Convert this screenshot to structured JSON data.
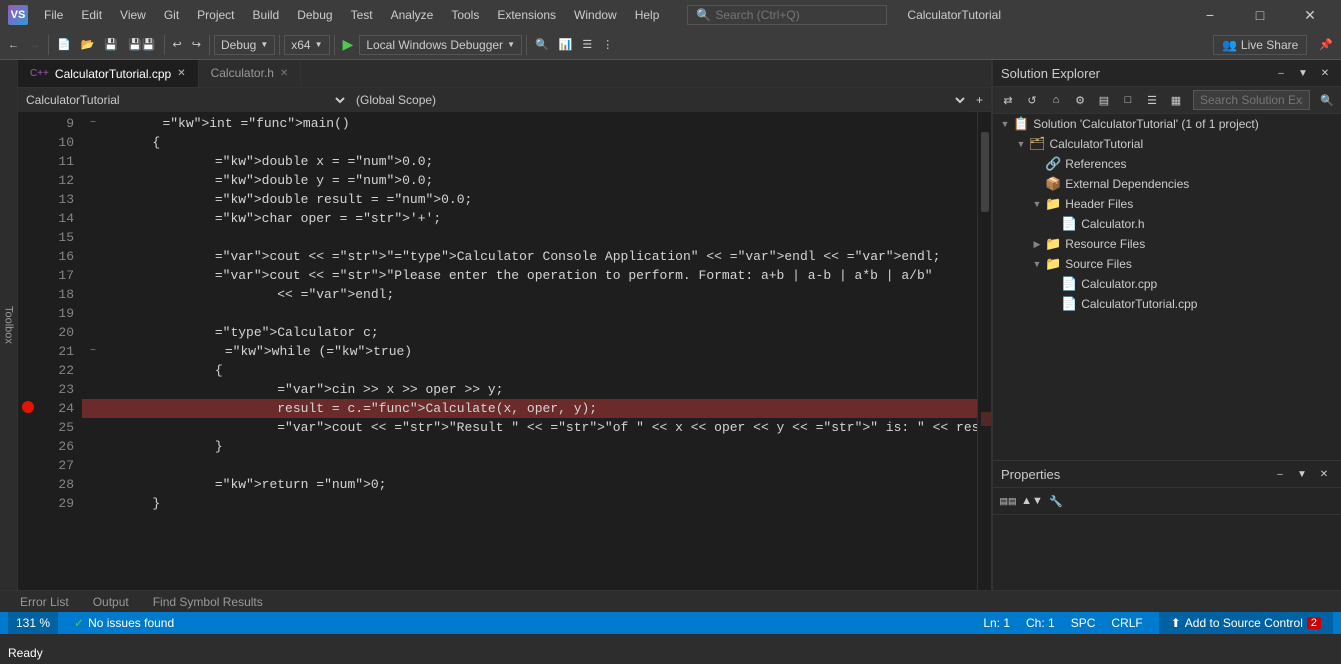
{
  "titleBar": {
    "logo": "VS",
    "menus": [
      "File",
      "Edit",
      "View",
      "Git",
      "Project",
      "Build",
      "Debug",
      "Test",
      "Analyze",
      "Tools",
      "Extensions",
      "Window",
      "Help"
    ],
    "search": {
      "placeholder": "Search (Ctrl+Q)"
    },
    "windowTitle": "CalculatorTutorial",
    "controls": [
      "minimize",
      "restore",
      "close"
    ]
  },
  "toolbar": {
    "debug_config": "Debug",
    "platform": "x64",
    "run_label": "Local Windows Debugger",
    "live_share": "Live Share"
  },
  "editor": {
    "tabs": [
      {
        "label": "CalculatorTutorial.cpp",
        "active": true
      },
      {
        "label": "Calculator.h",
        "active": false
      }
    ],
    "nav": {
      "scope": "CalculatorTutorial",
      "context": "(Global Scope)"
    },
    "lines": [
      {
        "num": 9,
        "content": "\tint main()",
        "indent": 1,
        "collapse": true
      },
      {
        "num": 10,
        "content": "\t{",
        "indent": 1
      },
      {
        "num": 11,
        "content": "\t\tdouble x = 0.0;",
        "indent": 2
      },
      {
        "num": 12,
        "content": "\t\tdouble y = 0.0;",
        "indent": 2
      },
      {
        "num": 13,
        "content": "\t\tdouble result = 0.0;",
        "indent": 2
      },
      {
        "num": 14,
        "content": "\t\tchar oper = '+';",
        "indent": 2
      },
      {
        "num": 15,
        "content": "",
        "indent": 0
      },
      {
        "num": 16,
        "content": "\t\tcout << \"Calculator Console Application\" << endl << endl;",
        "indent": 2
      },
      {
        "num": 17,
        "content": "\t\tcout << \"Please enter the operation to perform. Format: a+b | a-b | a*b | a/b\"",
        "indent": 2
      },
      {
        "num": 18,
        "content": "\t\t\t<< endl;",
        "indent": 3
      },
      {
        "num": 19,
        "content": "",
        "indent": 0
      },
      {
        "num": 20,
        "content": "\t\tCalculator c;",
        "indent": 2
      },
      {
        "num": 21,
        "content": "\t\twhile (true)",
        "indent": 2,
        "collapse": true
      },
      {
        "num": 22,
        "content": "\t\t{",
        "indent": 2
      },
      {
        "num": 23,
        "content": "\t\t\tcin >> x >> oper >> y;",
        "indent": 3
      },
      {
        "num": 24,
        "content": "\t\t\tresult = c.Calculate(x, oper, y);",
        "indent": 3,
        "highlighted": true,
        "breakpoint": true
      },
      {
        "num": 25,
        "content": "\t\t\tcout << \"Result \" << \"of \" << x << oper << y << \" is: \" << result << endl;",
        "indent": 3
      },
      {
        "num": 26,
        "content": "\t\t}",
        "indent": 2
      },
      {
        "num": 27,
        "content": "",
        "indent": 0
      },
      {
        "num": 28,
        "content": "\t\treturn 0;",
        "indent": 2
      },
      {
        "num": 29,
        "content": "\t}",
        "indent": 1
      }
    ]
  },
  "solutionExplorer": {
    "title": "Solution Explorer",
    "search_placeholder": "Search Solution Explorer (Ctrl+;)",
    "tree": [
      {
        "level": 0,
        "icon": "solution",
        "label": "Solution 'CalculatorTutorial' (1 of 1 project)",
        "expanded": true
      },
      {
        "level": 1,
        "icon": "project",
        "label": "CalculatorTutorial",
        "expanded": true
      },
      {
        "level": 2,
        "icon": "references",
        "label": "References",
        "expanded": false
      },
      {
        "level": 2,
        "icon": "ext-deps",
        "label": "External Dependencies",
        "expanded": false
      },
      {
        "level": 2,
        "icon": "folder",
        "label": "Header Files",
        "expanded": true
      },
      {
        "level": 3,
        "icon": "h-file",
        "label": "Calculator.h",
        "expanded": false
      },
      {
        "level": 2,
        "icon": "folder",
        "label": "Resource Files",
        "expanded": false
      },
      {
        "level": 2,
        "icon": "folder",
        "label": "Source Files",
        "expanded": true
      },
      {
        "level": 3,
        "icon": "cpp-file",
        "label": "Calculator.cpp",
        "expanded": false
      },
      {
        "level": 3,
        "icon": "cpp-file",
        "label": "CalculatorTutorial.cpp",
        "expanded": false
      }
    ]
  },
  "properties": {
    "title": "Properties"
  },
  "bottomTabs": [
    "Error List",
    "Output",
    "Find Symbol Results"
  ],
  "statusBar": {
    "ready": "Ready",
    "zoom": "131 %",
    "issues": "No issues found",
    "ln": "Ln: 1",
    "ch": "Ch: 1",
    "encoding": "SPC",
    "line_ending": "CRLF",
    "add_source": "Add to Source Control",
    "error_count": "2"
  }
}
